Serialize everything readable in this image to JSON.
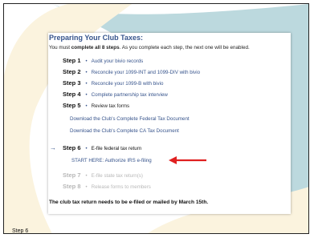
{
  "title": "Preparing Your Club Taxes:",
  "intro": {
    "prefix": "You must ",
    "bold": "complete all 8 steps",
    "suffix": ". As you complete each step, the next one will be enabled."
  },
  "steps": [
    {
      "num": "Step 1",
      "desc": "Audit your bivio records"
    },
    {
      "num": "Step 2",
      "desc": "Reconcile your 1099-INT and 1099-DIV with bivio"
    },
    {
      "num": "Step 3",
      "desc": "Reconcile your 1099-B with bivio"
    },
    {
      "num": "Step 4",
      "desc": "Complete partnership tax interview"
    },
    {
      "num": "Step 5",
      "desc": "Review tax forms"
    },
    {
      "num": "Step 6",
      "desc": "E-file federal tax return"
    },
    {
      "num": "Step 7",
      "desc": "E-file state tax return(s)"
    },
    {
      "num": "Step 8",
      "desc": "Release forms to members"
    }
  ],
  "links": {
    "federal": "Download the Club's Complete Federal Tax Document",
    "state": "Download the Club's Complete CA Tax Document"
  },
  "current_marker": "→",
  "start_link": "START HERE: Authorize IRS e-filing",
  "footer": "The club tax return needs to be e-filed or mailed by March 15th.",
  "caption": "Step 6",
  "colors": {
    "accent": "#37548c",
    "arrow": "#e02020",
    "bg_shape": "#bcd9de",
    "cream": "#fbf3de"
  }
}
